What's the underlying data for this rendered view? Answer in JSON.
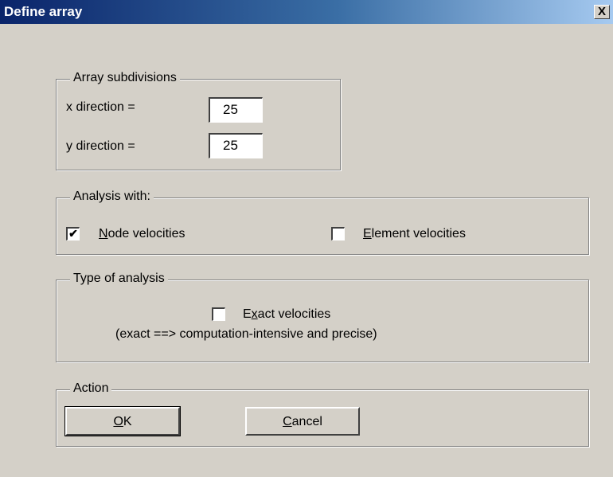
{
  "window": {
    "title": "Define array",
    "close_label": "X"
  },
  "array_subdivisions": {
    "legend": "Array subdivisions",
    "x_label": "x direction =",
    "x_value": "25",
    "y_label": "y direction =",
    "y_value": "25"
  },
  "analysis_with": {
    "legend": "Analysis with:",
    "node_label_first": "N",
    "node_label_rest": "ode velocities",
    "node_checked": "✔",
    "element_label_first": "E",
    "element_label_rest": "lement velocities",
    "element_checked": ""
  },
  "type_of_analysis": {
    "legend": "Type of analysis",
    "exact_label_pre": "E",
    "exact_label_key": "x",
    "exact_label_rest": "act velocities",
    "exact_checked": "",
    "note": "(exact ==> computation-intensive and precise)"
  },
  "action": {
    "legend": "Action",
    "ok_first": "O",
    "ok_rest": "K",
    "cancel_first": "C",
    "cancel_rest": "ancel"
  }
}
